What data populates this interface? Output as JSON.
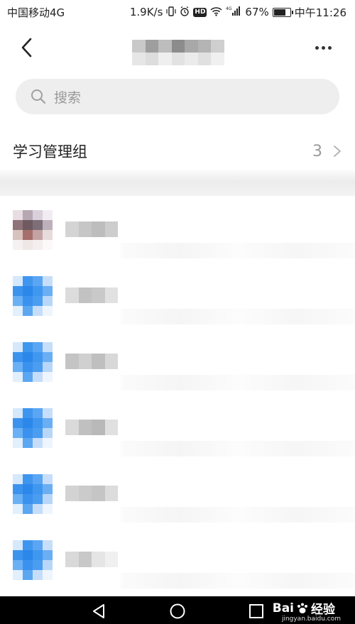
{
  "status_bar": {
    "carrier": "中国移动4G",
    "net_speed": "1.9K/s",
    "hd_badge": "HD",
    "network_type": "4G",
    "battery_percent": "67%",
    "battery_level": 0.67,
    "time": "中午11:26"
  },
  "search": {
    "placeholder": "搜索"
  },
  "group": {
    "title": "学习管理组",
    "count": "3"
  },
  "members": [
    {
      "avatar_style": "photo"
    },
    {
      "avatar_style": "blue"
    },
    {
      "avatar_style": "blue"
    },
    {
      "avatar_style": "blue"
    },
    {
      "avatar_style": "blue"
    },
    {
      "avatar_style": "blue"
    }
  ],
  "watermark": {
    "brand": "Bai",
    "brand_suffix": "经验",
    "url": "jingyan.baidu.com"
  },
  "colors": {
    "accent_blue": "#3d95f0",
    "search_bg": "#eeeeee",
    "muted_text": "#9a9a9a"
  }
}
